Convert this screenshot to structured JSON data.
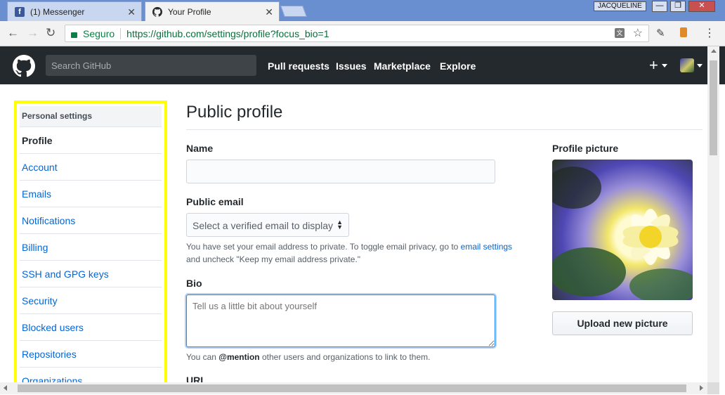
{
  "browser": {
    "tabs": [
      {
        "title": "(1) Messenger",
        "active": false
      },
      {
        "title": "Your Profile",
        "active": true
      }
    ],
    "user_chip": "JACQUELINE",
    "window_buttons": [
      "—",
      "❐",
      "✕"
    ],
    "secure_label": "Seguro",
    "url": "https://github.com/settings/profile?focus_bio=1"
  },
  "github": {
    "search_placeholder": "Search GitHub",
    "nav": [
      "Pull requests",
      "Issues",
      "Marketplace",
      "Explore"
    ],
    "plus": "+"
  },
  "sidebar": {
    "header": "Personal settings",
    "items": [
      "Profile",
      "Account",
      "Emails",
      "Notifications",
      "Billing",
      "SSH and GPG keys",
      "Security",
      "Blocked users",
      "Repositories",
      "Organizations"
    ],
    "selected": "Profile"
  },
  "main": {
    "title": "Public profile",
    "name_label": "Name",
    "name_value": "",
    "email_label": "Public email",
    "email_select": "Select a verified email to display",
    "email_note_1": "You have set your email address to private. To toggle email privacy, go to ",
    "email_note_link": "email settings",
    "email_note_2": "and uncheck \"Keep my email address private.\"",
    "bio_label": "Bio",
    "bio_placeholder": "Tell us a little bit about yourself",
    "bio_note_pre": "You can ",
    "bio_note_mention": "@mention",
    "bio_note_post": " other users and organizations to link to them.",
    "url_label": "URL",
    "picture_label": "Profile picture",
    "upload_button": "Upload new picture"
  },
  "colors": {
    "highlight": "#ffff00",
    "header_bg": "#24292e",
    "link": "#0366d6",
    "secure_green": "#0b8043"
  }
}
